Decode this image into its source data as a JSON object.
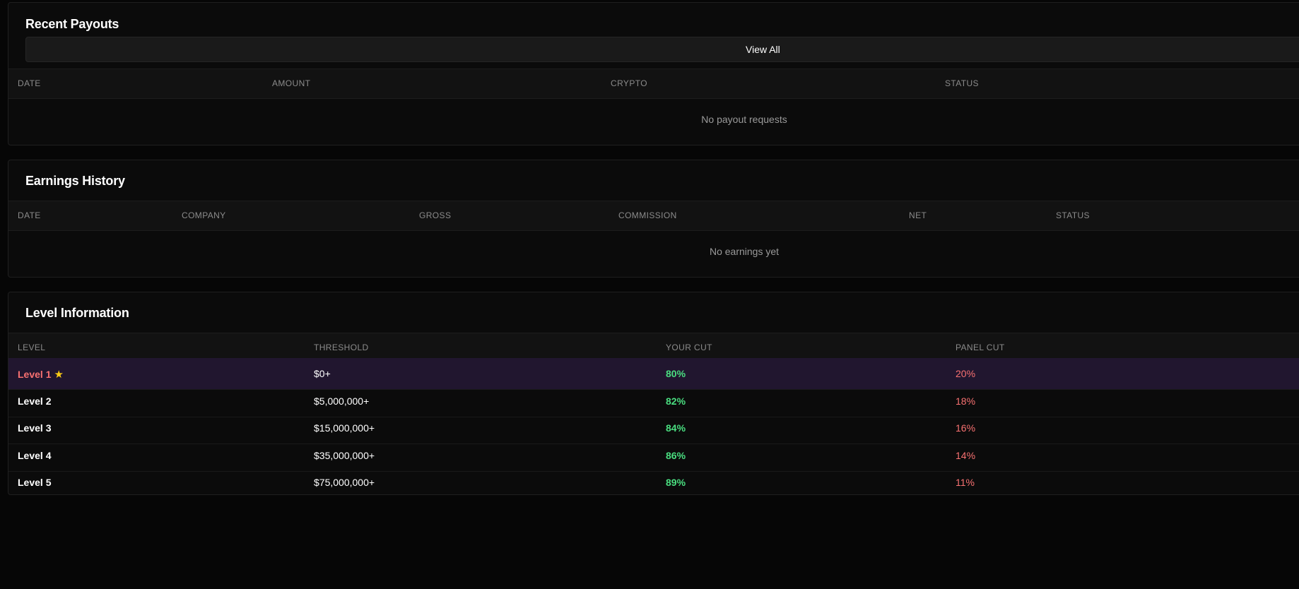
{
  "recent_payouts": {
    "title": "Recent Payouts",
    "view_all_label": "View All",
    "columns": [
      "DATE",
      "AMOUNT",
      "CRYPTO",
      "STATUS"
    ],
    "empty_text": "No payout requests"
  },
  "earnings_history": {
    "title": "Earnings History",
    "columns": [
      "DATE",
      "COMPANY",
      "GROSS",
      "COMMISSION",
      "NET",
      "STATUS"
    ],
    "empty_text": "No earnings yet"
  },
  "level_information": {
    "title": "Level Information",
    "columns": [
      "LEVEL",
      "THRESHOLD",
      "YOUR CUT",
      "PANEL CUT"
    ],
    "current_marker": "★",
    "rows": [
      {
        "level": "Level 1",
        "threshold": "$0+",
        "your_cut": "80%",
        "panel_cut": "20%",
        "current": true
      },
      {
        "level": "Level 2",
        "threshold": "$5,000,000+",
        "your_cut": "82%",
        "panel_cut": "18%",
        "current": false
      },
      {
        "level": "Level 3",
        "threshold": "$15,000,000+",
        "your_cut": "84%",
        "panel_cut": "16%",
        "current": false
      },
      {
        "level": "Level 4",
        "threshold": "$35,000,000+",
        "your_cut": "86%",
        "panel_cut": "14%",
        "current": false
      },
      {
        "level": "Level 5",
        "threshold": "$75,000,000+",
        "your_cut": "89%",
        "panel_cut": "11%",
        "current": false
      }
    ]
  },
  "colors": {
    "background": "#060606",
    "card": "#0b0b0b",
    "header_row": "#121212",
    "current_row": "#21162f",
    "your_cut": "#4ade80",
    "panel_cut": "#f87171",
    "star": "#facc15"
  }
}
